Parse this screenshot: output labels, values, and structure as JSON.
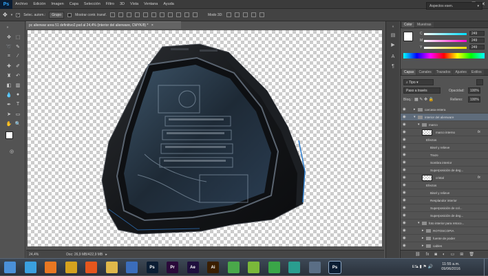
{
  "app": {
    "logo": "Ps",
    "menu": [
      "Archivo",
      "Edición",
      "Imagen",
      "Capa",
      "Selección",
      "Filtro",
      "3D",
      "Vista",
      "Ventana",
      "Ayuda"
    ],
    "window_controls": [
      "minimize-icon",
      "restore-icon",
      "close-icon"
    ]
  },
  "options": {
    "auto_select_label": "Selec. autom.:",
    "auto_select_value": "Grupo",
    "show_transform_label": "Mostrar contr. transf.",
    "mode_3d_label": "Modo 3D:",
    "workspace": "Aspectos esen."
  },
  "document": {
    "tab_title": "pc alienwar area 51 definitivo2.psd al 24,4% (interior del alienware, CMYK/8) *",
    "zoom": "24,4%",
    "doc_size": "Doc: 26,9 MB/422,9 MB"
  },
  "color_panel": {
    "tabs": [
      "Color",
      "Muestras"
    ],
    "channels": [
      {
        "label": "C",
        "value": "249",
        "grad": "#ffffff,#00e0ff"
      },
      {
        "label": "M",
        "value": "249",
        "grad": "#ffffff,#ff00d0"
      },
      {
        "label": "Y",
        "value": "249",
        "grad": "#ffffff,#f0e000"
      }
    ]
  },
  "layers_panel": {
    "tabs": [
      "Capas",
      "Canales",
      "Trazados",
      "Ajustes",
      "Estilos"
    ],
    "filter_kind": "Tipo",
    "blend_mode": "Paso a través",
    "opacity_label": "Opacidad:",
    "opacity_value": "100%",
    "lock_label": "Bloq.:",
    "fill_label": "Relleno:",
    "fill_value": "100%",
    "layers": [
      {
        "name": "carcasa entera",
        "indent": 1,
        "type": "group",
        "eye": true,
        "selected": false
      },
      {
        "name": "interior del alienware",
        "indent": 1,
        "type": "group-open",
        "eye": true,
        "selected": true
      },
      {
        "name": "marco",
        "indent": 2,
        "type": "group-open",
        "eye": true,
        "selected": false
      },
      {
        "name": "marco interno",
        "indent": 3,
        "type": "layer-fx",
        "eye": true,
        "selected": false,
        "fx": "fx"
      },
      {
        "name": "Efectos",
        "indent": 4,
        "type": "effects",
        "eye": true,
        "selected": false
      },
      {
        "name": "Bisel y relieve",
        "indent": 5,
        "type": "effect",
        "eye": true,
        "selected": false
      },
      {
        "name": "Trazo",
        "indent": 5,
        "type": "effect",
        "eye": true,
        "selected": false
      },
      {
        "name": "Sombra interior",
        "indent": 5,
        "type": "effect",
        "eye": true,
        "selected": false
      },
      {
        "name": "Superposición de deg...",
        "indent": 5,
        "type": "effect",
        "eye": true,
        "selected": false
      },
      {
        "name": "cristal",
        "indent": 3,
        "type": "layer-fx",
        "eye": true,
        "selected": false,
        "fx": "fx"
      },
      {
        "name": "Efectos",
        "indent": 4,
        "type": "effects",
        "eye": true,
        "selected": false
      },
      {
        "name": "Bisel y relieve",
        "indent": 5,
        "type": "effect",
        "eye": true,
        "selected": false
      },
      {
        "name": "Resplandor interior",
        "indent": 5,
        "type": "effect",
        "eye": true,
        "selected": false
      },
      {
        "name": "Superposición de col...",
        "indent": 5,
        "type": "effect",
        "eye": true,
        "selected": false
      },
      {
        "name": "Superposición de deg...",
        "indent": 5,
        "type": "effect",
        "eye": true,
        "selected": false
      },
      {
        "name": "foto interior para retoco...",
        "indent": 2,
        "type": "group-open",
        "eye": true,
        "selected": false
      },
      {
        "name": "ROTOSCOPIA",
        "indent": 3,
        "type": "group",
        "eye": true,
        "selected": false
      },
      {
        "name": "fuente de poder",
        "indent": 3,
        "type": "group",
        "eye": true,
        "selected": false
      },
      {
        "name": "cables",
        "indent": 3,
        "type": "group",
        "eye": true,
        "selected": false
      }
    ],
    "bottom_icons": [
      "link-icon",
      "fx-icon",
      "mask-icon",
      "adjustment-icon",
      "folder-icon",
      "new-layer-icon",
      "trash-icon"
    ]
  },
  "taskbar": {
    "apps": [
      {
        "name": "start-icon",
        "label": "",
        "color": "#4a90d9"
      },
      {
        "name": "media-icon",
        "label": "",
        "color": "#3aa0e0"
      },
      {
        "name": "daemon-icon",
        "label": "",
        "color": "#e87722"
      },
      {
        "name": "chrome-icon",
        "label": "",
        "color": "#d6a21e"
      },
      {
        "name": "firefox-icon",
        "label": "",
        "color": "#e5561d"
      },
      {
        "name": "explorer-icon",
        "label": "",
        "color": "#e0b84a"
      },
      {
        "name": "app-icon",
        "label": "",
        "color": "#3b6dbb"
      },
      {
        "name": "photoshop-icon",
        "label": "Ps",
        "color": "#0b1d33"
      },
      {
        "name": "premiere-icon",
        "label": "Pr",
        "color": "#2a0a3a"
      },
      {
        "name": "aftereffects-icon",
        "label": "Ae",
        "color": "#1f0f3d"
      },
      {
        "name": "illustrator-icon",
        "label": "Ai",
        "color": "#3a1e00"
      },
      {
        "name": "camtasia-icon",
        "label": "",
        "color": "#4aa84a"
      },
      {
        "name": "tool-icon",
        "label": "",
        "color": "#7ab83a"
      },
      {
        "name": "green-app-icon",
        "label": "",
        "color": "#3aa648"
      },
      {
        "name": "gallery-icon",
        "label": "",
        "color": "#2a9d8f"
      },
      {
        "name": "window-app-icon",
        "label": "",
        "color": "#5a6e85"
      },
      {
        "name": "photoshop-active-icon",
        "label": "Ps",
        "color": "#0b1d33"
      }
    ],
    "language": "ES",
    "time": "11:55 a.m.",
    "date": "09/06/2016"
  }
}
